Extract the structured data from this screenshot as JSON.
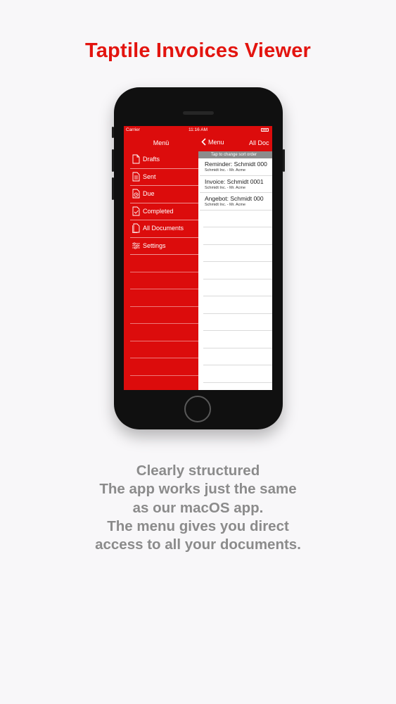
{
  "headline": "Taptile Invoices Viewer",
  "status_bar": {
    "carrier": "Carrier",
    "time": "11:16 AM"
  },
  "menu": {
    "title": "Menü",
    "items": [
      {
        "label": "Drafts",
        "icon": "document-icon"
      },
      {
        "label": "Sent",
        "icon": "sent-document-icon"
      },
      {
        "label": "Due",
        "icon": "clock-document-icon"
      },
      {
        "label": "Completed",
        "icon": "check-document-icon"
      },
      {
        "label": "All Documents",
        "icon": "documents-icon"
      },
      {
        "label": "Settings",
        "icon": "sliders-icon"
      }
    ]
  },
  "documents": {
    "back_label": "Menu",
    "title": "All Doc",
    "sort_hint": "Tap to change sort order",
    "rows": [
      {
        "title": "Reminder: Schmidt 000",
        "subtitle": "Schmidt Inc. - Mr. Acme"
      },
      {
        "title": "Invoice: Schmidt 0001",
        "subtitle": "Schmidt Inc. - Mr. Acme"
      },
      {
        "title": "Angebot: Schmidt 000",
        "subtitle": "Schmidt Inc. - Mr. Acme"
      }
    ]
  },
  "caption": [
    "Clearly structured",
    "The app works just the same",
    "as our macOS app.",
    "The menu gives you direct",
    "access to all your documents."
  ],
  "colors": {
    "brand_red": "#dc0c0c",
    "headline_red": "#e3140f",
    "caption_gray": "#8b8b8b"
  }
}
